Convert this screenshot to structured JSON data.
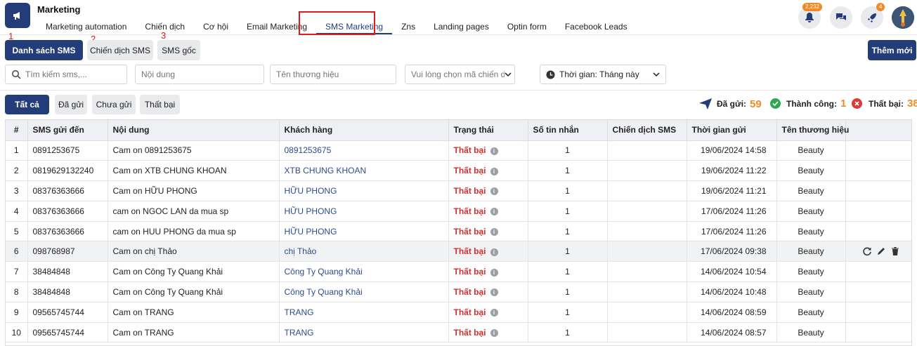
{
  "app": {
    "title": "Marketing"
  },
  "nav": [
    {
      "label": "Marketing automation"
    },
    {
      "label": "Chiến dịch"
    },
    {
      "label": "Cơ hội"
    },
    {
      "label": "Email Marketing"
    },
    {
      "label": "SMS Marketing"
    },
    {
      "label": "Zns"
    },
    {
      "label": "Landing pages"
    },
    {
      "label": "Optin form"
    },
    {
      "label": "Facebook Leads"
    }
  ],
  "header_badges": {
    "notifications": "2,232",
    "rocket": "4"
  },
  "annotations": {
    "n1": "1",
    "n2": "2",
    "n3": "3"
  },
  "subtabs": {
    "list": "Danh sách SMS",
    "campaign": "Chiến dịch SMS",
    "original": "SMS gốc"
  },
  "add_button": "Thêm mới",
  "filters": {
    "search_placeholder": "Tìm kiếm sms,...",
    "content_placeholder": "Nội dung",
    "brand_placeholder": "Tên thương hiệu",
    "campaign_placeholder": "Vui lòng chọn mã chiến dịch",
    "time_label": "Thời gian: Tháng này"
  },
  "status_tabs": {
    "all": "Tất cả",
    "sent": "Đã gửi",
    "unsent": "Chưa gửi",
    "failed": "Thất bại"
  },
  "stats": {
    "sent_label": "Đã gửi:",
    "sent_value": "59",
    "success_label": "Thành công:",
    "success_value": "1",
    "failed_label": "Thất bại:",
    "failed_value": "38"
  },
  "table": {
    "columns": [
      "#",
      "SMS gửi đến",
      "Nội dung",
      "Khách hàng",
      "Trạng thái",
      "Số tin nhắn",
      "Chiến dịch SMS",
      "Thời gian gửi",
      "Tên thương hiệu"
    ],
    "rows": [
      {
        "idx": "1",
        "phone": "0891253675",
        "content": "Cam on 0891253675",
        "customer": "0891253675",
        "status": "Thất bại",
        "count": "1",
        "campaign": "",
        "time": "19/06/2024 14:58",
        "brand": "Beauty"
      },
      {
        "idx": "2",
        "phone": "0819629132240",
        "content": "Cam on XTB CHUNG KHOAN",
        "customer": "XTB CHUNG KHOAN",
        "status": "Thất bại",
        "count": "1",
        "campaign": "",
        "time": "19/06/2024 11:22",
        "brand": "Beauty"
      },
      {
        "idx": "3",
        "phone": "08376363666",
        "content": "Cam on HỮU PHONG",
        "customer": "HỮU PHONG",
        "status": "Thất bại",
        "count": "1",
        "campaign": "",
        "time": "19/06/2024 11:21",
        "brand": "Beauty"
      },
      {
        "idx": "4",
        "phone": "08376363666",
        "content": "cam on NGOC LAN da mua sp",
        "customer": "HỮU PHONG",
        "status": "Thất bại",
        "count": "1",
        "campaign": "",
        "time": "17/06/2024 11:26",
        "brand": "Beauty"
      },
      {
        "idx": "5",
        "phone": "08376363666",
        "content": "cam on HUU PHONG da mua sp",
        "customer": "HỮU PHONG",
        "status": "Thất bại",
        "count": "1",
        "campaign": "",
        "time": "17/06/2024 11:26",
        "brand": "Beauty"
      },
      {
        "idx": "6",
        "phone": "098768987",
        "content": "Cam on chị Thảo",
        "customer": "chị Thảo",
        "status": "Thất bại",
        "count": "1",
        "campaign": "",
        "time": "17/06/2024 09:38",
        "brand": "Beauty"
      },
      {
        "idx": "7",
        "phone": "38484848",
        "content": "Cam on Công Ty Quang Khải",
        "customer": "Công Ty Quang Khải",
        "status": "Thất bại",
        "count": "1",
        "campaign": "",
        "time": "14/06/2024 10:54",
        "brand": "Beauty"
      },
      {
        "idx": "8",
        "phone": "38484848",
        "content": "Cam on Công Ty Quang Khải",
        "customer": "Công Ty Quang Khải",
        "status": "Thất bại",
        "count": "1",
        "campaign": "",
        "time": "14/06/2024 10:48",
        "brand": "Beauty"
      },
      {
        "idx": "9",
        "phone": "09565745744",
        "content": "Cam on TRANG",
        "customer": "TRANG",
        "status": "Thất bại",
        "count": "1",
        "campaign": "",
        "time": "14/06/2024 08:59",
        "brand": "Beauty"
      },
      {
        "idx": "10",
        "phone": "09565745744",
        "content": "Cam on TRANG",
        "customer": "TRANG",
        "status": "Thất bại",
        "count": "1",
        "campaign": "",
        "time": "14/06/2024 08:57",
        "brand": "Beauty"
      }
    ]
  },
  "colors": {
    "primary": "#233d7b",
    "accent": "#f08a24",
    "danger": "#d32f2f",
    "success": "#2fa84f",
    "annotation": "#e01b1b"
  }
}
